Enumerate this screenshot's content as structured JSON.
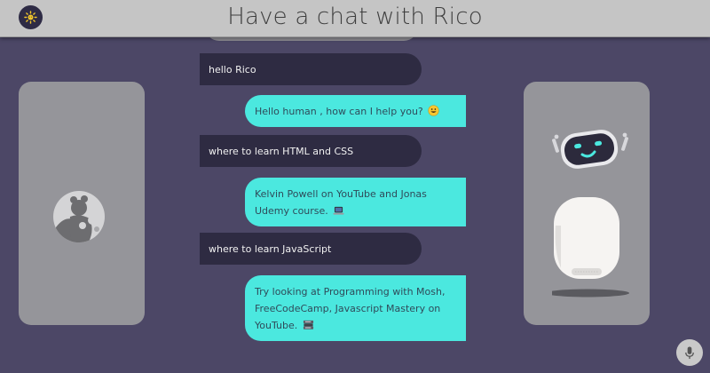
{
  "header": {
    "title": "Have a chat with Rico",
    "theme_icon": "sun-icon"
  },
  "chat": {
    "messages": [
      {
        "sender": "user",
        "text": "hello Rico"
      },
      {
        "sender": "bot",
        "text": "Hello human , how can I help you?",
        "emoji": "grinning-face-icon"
      },
      {
        "sender": "user",
        "text": "where to learn HTML and CSS"
      },
      {
        "sender": "bot",
        "text": "Kelvin Powell on YouTube and Jonas Udemy course.",
        "emoji": "laptop-icon"
      },
      {
        "sender": "user",
        "text": "where to learn JavaScript"
      },
      {
        "sender": "bot",
        "text": "Try looking at Programming with Mosh, FreeCodeCamp, Javascript Mastery on YouTube.",
        "emoji": "books-icon"
      }
    ]
  },
  "panels": {
    "left": {
      "icon": "user-avatar-icon"
    },
    "right": {
      "icon": "robot-icon"
    }
  },
  "controls": {
    "mic_icon": "microphone-icon"
  },
  "colors": {
    "background": "#4c4766",
    "header": "#c5c5c5",
    "user_bubble": "#2e2b42",
    "bot_bubble": "#4be8df",
    "panel": "#95959a"
  }
}
